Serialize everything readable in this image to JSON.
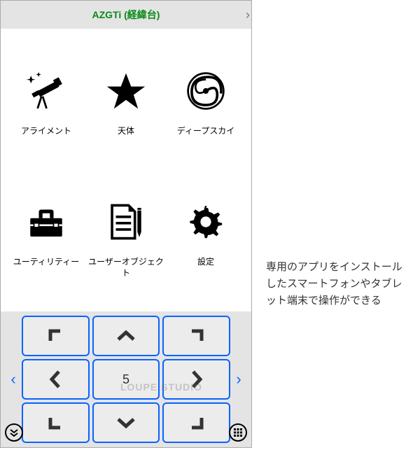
{
  "titlebar": {
    "title": "AZGTi (経緯台)"
  },
  "menu": {
    "items": [
      {
        "label": "アライメント",
        "icon": "telescope-icon"
      },
      {
        "label": "天体",
        "icon": "star-icon"
      },
      {
        "label": "ディープスカイ",
        "icon": "spiral-icon"
      },
      {
        "label": "ユーティリティー",
        "icon": "toolbox-icon"
      },
      {
        "label": "ユーザーオブジェクト",
        "icon": "document-edit-icon"
      },
      {
        "label": "設定",
        "icon": "gear-icon"
      }
    ]
  },
  "dpad": {
    "center_value": "5",
    "buttons": {
      "nw": "┏",
      "n": "︿",
      "ne": "┓",
      "w": "く",
      "e": "〉",
      "sw": "┗",
      "s": "﹀",
      "se": "┛"
    }
  },
  "watermark": "LOUPE STUDIO",
  "caption": "専用のアプリをインストールしたスマートフォンやタブレット端末で操作ができる"
}
